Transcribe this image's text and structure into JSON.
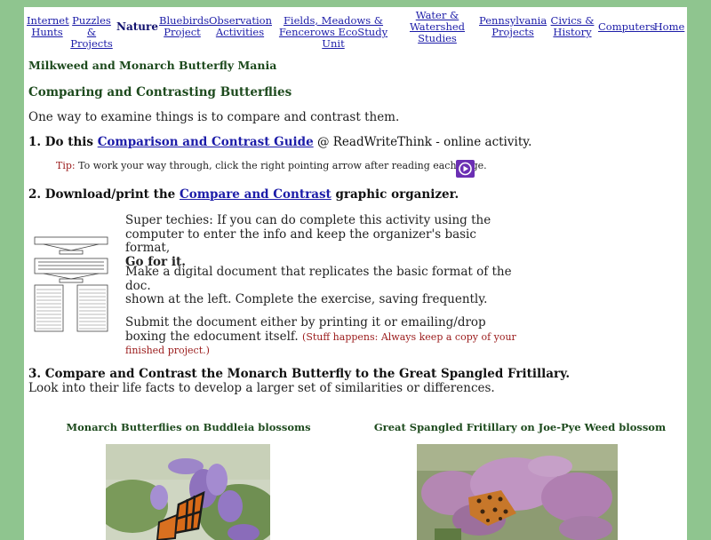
{
  "nav": [
    {
      "label": "Internet\nHunts"
    },
    {
      "label": "Puzzles &\nProjects"
    },
    {
      "label": "Nature"
    },
    {
      "label": "Bluebirds\nProject"
    },
    {
      "label": "Observation\nActivities"
    },
    {
      "label": "Fields, Meadows &\nFencerows EcoStudy Unit"
    },
    {
      "label": "Water &\nWatershed\nStudies"
    },
    {
      "label": "Pennsylvania\nProjects"
    },
    {
      "label": "Civics &\nHistory"
    },
    {
      "label": "Computers"
    },
    {
      "label": "Home"
    }
  ],
  "header": {
    "site_title": "Milkweed and Monarch Butterfly Mania",
    "page_title": "Comparing and Contrasting Butterflies",
    "intro": "One way to examine things is to compare and contrast them."
  },
  "step1": {
    "prefix": "1. Do this ",
    "link": "Comparison and Contrast Guide",
    "suffix": " @ ReadWriteThink - online activity.",
    "tip_label": "Tip:",
    "tip_text": " To work your way through, click the right pointing arrow after reading each page."
  },
  "step2": {
    "prefix": "2. Download/print the ",
    "link": "Compare and Contrast",
    "suffix": " graphic organizer.",
    "para1": "Super techies: If you can do complete this activity using the computer to enter the info and keep the organizer's basic format,",
    "para1_bold": "Go for it",
    "para1_end": ".",
    "para2a": "Make a digital document that replicates the basic format of the doc.",
    "para2b": "shown at the left. Complete the exercise, saving frequently.",
    "para3": "Submit the document either by printing it or emailing/drop boxing the edocument itself. ",
    "para3_note": "(Stuff happens: Always keep a copy of your finished project.)"
  },
  "step3": {
    "title": "3. Compare and Contrast the Monarch Butterfly to the Great Spangled Fritillary.",
    "text": "Look into their life facts to develop a larger set of similarities or differences."
  },
  "photos": {
    "left_caption": "Monarch Butterflies on Buddleia blossoms",
    "right_caption": "Great Spangled Fritillary on Joe-Pye Weed blossom"
  },
  "colors": {
    "page_border": "#8fc58f",
    "title_green": "#1d4a1d",
    "link_blue": "#1c1ca8",
    "tip_red": "#9a1a1a",
    "play_purple": "#6b2fb3"
  }
}
